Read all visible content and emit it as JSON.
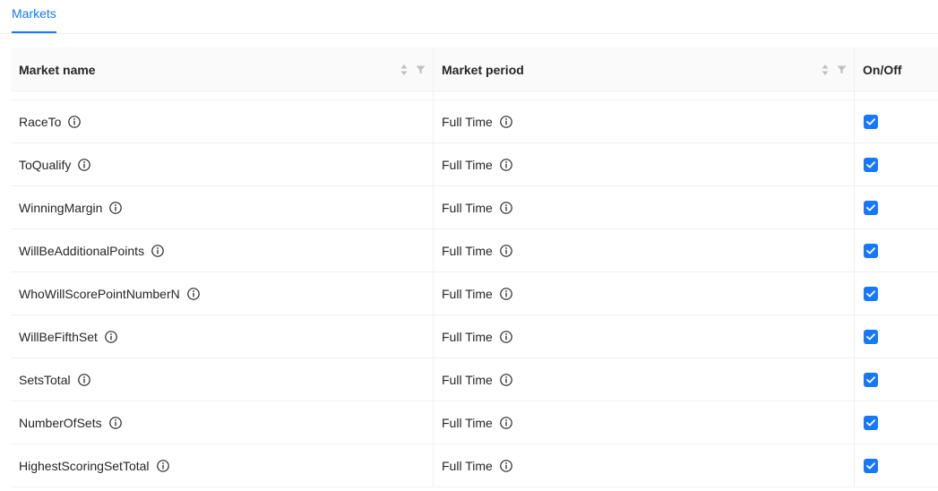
{
  "tabs": [
    {
      "label": "Markets",
      "active": true
    }
  ],
  "colors": {
    "accent": "#1677ff",
    "header_bg": "#fafafa",
    "border": "#f0f0f0"
  },
  "table": {
    "columns": [
      {
        "label": "Market name",
        "sortable": true,
        "filterable": true
      },
      {
        "label": "Market period",
        "sortable": true,
        "filterable": true
      },
      {
        "label": "On/Off",
        "sortable": false,
        "filterable": false
      }
    ],
    "rows": [
      {
        "name": "RaceTo",
        "period": "Full Time",
        "enabled": true
      },
      {
        "name": "ToQualify",
        "period": "Full Time",
        "enabled": true
      },
      {
        "name": "WinningMargin",
        "period": "Full Time",
        "enabled": true
      },
      {
        "name": "WillBeAdditionalPoints",
        "period": "Full Time",
        "enabled": true
      },
      {
        "name": "WhoWillScorePointNumberN",
        "period": "Full Time",
        "enabled": true
      },
      {
        "name": "WillBeFifthSet",
        "period": "Full Time",
        "enabled": true
      },
      {
        "name": "SetsTotal",
        "period": "Full Time",
        "enabled": true
      },
      {
        "name": "NumberOfSets",
        "period": "Full Time",
        "enabled": true
      },
      {
        "name": "HighestScoringSetTotal",
        "period": "Full Time",
        "enabled": true
      }
    ]
  },
  "icons": {
    "info": "info-circle-icon",
    "sort": "sort-icon",
    "filter": "filter-icon",
    "check": "check-icon"
  }
}
